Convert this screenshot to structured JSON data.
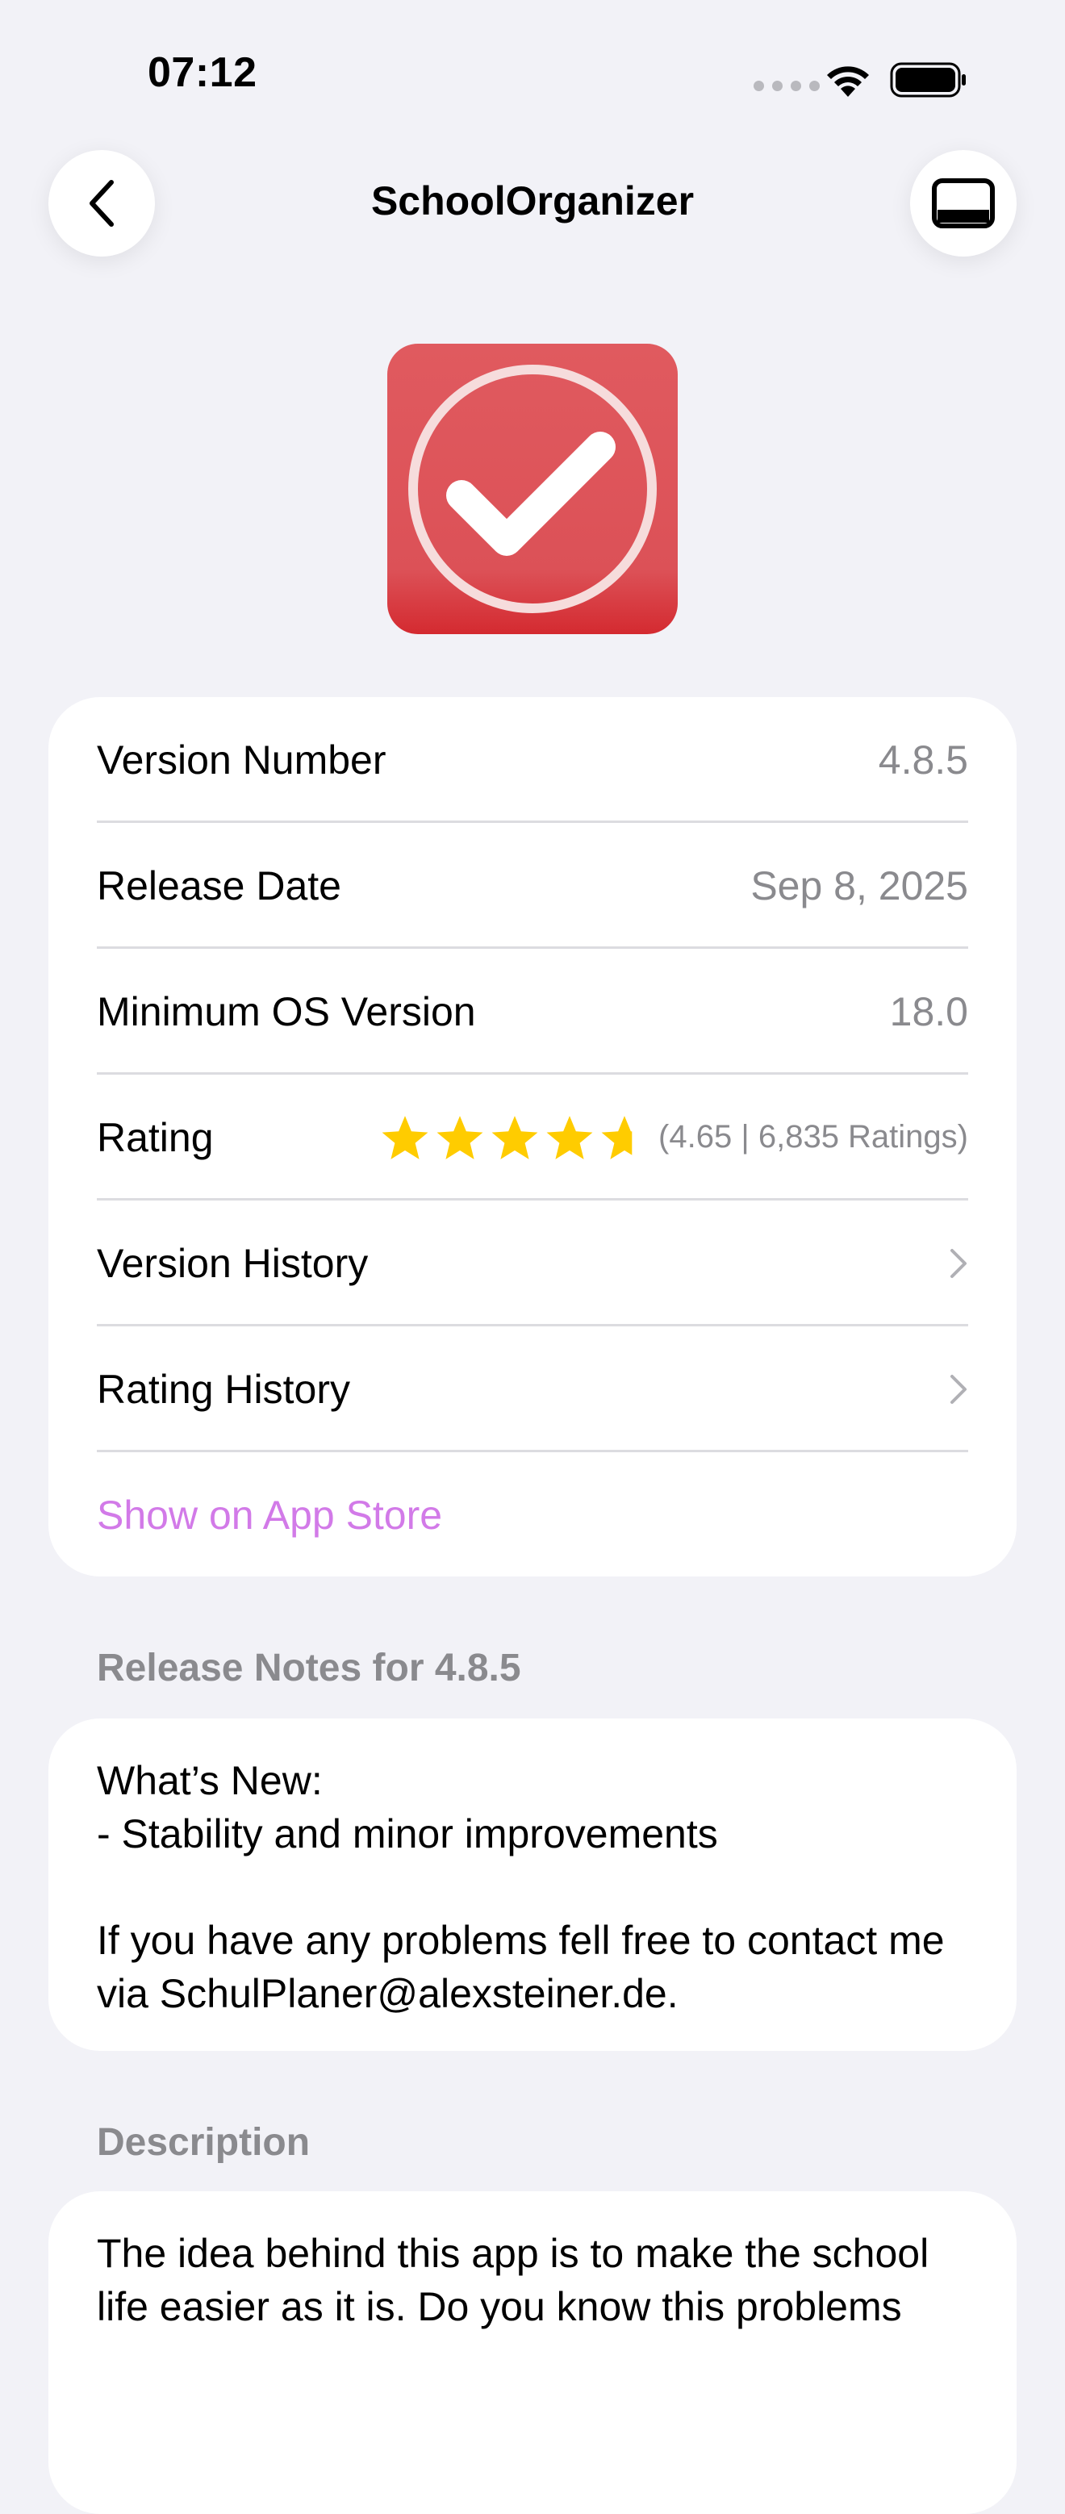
{
  "status_bar": {
    "time": "07:12"
  },
  "nav": {
    "title": "SchoolOrganizer"
  },
  "app": {
    "icon": "checkmark-circle-icon",
    "brand_color": "#dc5157"
  },
  "info": {
    "version_label": "Version Number",
    "version_value": "4.8.5",
    "release_label": "Release Date",
    "release_value": "Sep 8, 2025",
    "min_os_label": "Minimum OS Version",
    "min_os_value": "18.0",
    "rating_label": "Rating",
    "rating_value": 4.65,
    "rating_max": 5,
    "rating_text": "(4.65 | 6,835 Ratings)",
    "version_history_label": "Version History",
    "rating_history_label": "Rating History",
    "store_link_label": "Show on App Store"
  },
  "release_notes": {
    "heading": "Release Notes for 4.8.5",
    "body": "What’s New:\n- Stability and minor improvements\n\nIf you have any problems fell free to contact me via SchulPlaner@alexsteiner.de."
  },
  "description": {
    "heading": "Description",
    "body": "The idea behind this app is to make the school life easier as it is. Do you know this problems"
  },
  "colors": {
    "background": "#f2f2f7",
    "link": "#d27ae8",
    "star": "#ffcc00",
    "secondary_text": "#8a8a8e"
  }
}
